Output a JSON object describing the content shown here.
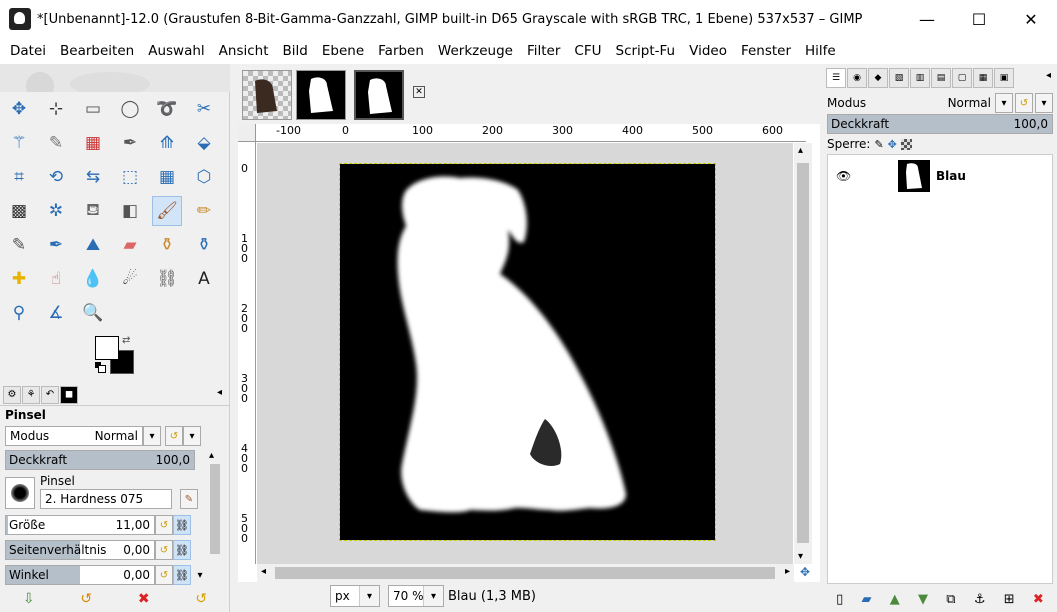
{
  "window": {
    "title": "*[Unbenannt]-12.0 (Graustufen 8-Bit-Gamma-Ganzzahl, GIMP built-in D65 Grayscale with sRGB TRC, 1 Ebene) 537x537 – GIMP",
    "minimize": "—",
    "maximize": "☐",
    "close": "✕"
  },
  "menu": [
    "Datei",
    "Bearbeiten",
    "Auswahl",
    "Ansicht",
    "Bild",
    "Ebene",
    "Farben",
    "Werkzeuge",
    "Filter",
    "CFU",
    "Script-Fu",
    "Video",
    "Fenster",
    "Hilfe"
  ],
  "tools": [
    {
      "name": "move-tool",
      "glyph": "✥",
      "color": "#2a6db5"
    },
    {
      "name": "align-tool",
      "glyph": "⊹",
      "color": "#333"
    },
    {
      "name": "rect-select-tool",
      "glyph": "▭",
      "color": "#555"
    },
    {
      "name": "ellipse-select-tool",
      "glyph": "◯",
      "color": "#555"
    },
    {
      "name": "free-select-tool",
      "glyph": "➰",
      "color": "#555"
    },
    {
      "name": "scissors-tool",
      "glyph": "✂",
      "color": "#2a6db5"
    },
    {
      "name": "fuzzy-select-tool",
      "glyph": "⚚",
      "color": "#2a6db5"
    },
    {
      "name": "magic-wand-tool",
      "glyph": "✎",
      "color": "#777"
    },
    {
      "name": "by-color-select-tool",
      "glyph": "▦",
      "color": "#c33"
    },
    {
      "name": "paths-tool",
      "glyph": "✒",
      "color": "#555"
    },
    {
      "name": "unified-transform-tool",
      "glyph": "⟰",
      "color": "#2a6db5"
    },
    {
      "name": "warp-transform-tool",
      "glyph": "⬙",
      "color": "#2a6db5"
    },
    {
      "name": "crop-tool",
      "glyph": "⌗",
      "color": "#2a6db5"
    },
    {
      "name": "rotate-tool",
      "glyph": "⟲",
      "color": "#2a6db5"
    },
    {
      "name": "flip-tool",
      "glyph": "⇆",
      "color": "#2a6db5"
    },
    {
      "name": "perspective-tool",
      "glyph": "⬚",
      "color": "#2a6db5"
    },
    {
      "name": "cage-tool",
      "glyph": "▦",
      "color": "#2a6db5"
    },
    {
      "name": "handle-transform-tool",
      "glyph": "⬡",
      "color": "#2a6db5"
    },
    {
      "name": "mypaint-brush-tool",
      "glyph": "▩",
      "color": "#333"
    },
    {
      "name": "heal-tool",
      "glyph": "✲",
      "color": "#2a6db5"
    },
    {
      "name": "bucket-fill-tool",
      "glyph": "⛾",
      "color": "#666"
    },
    {
      "name": "gradient-tool",
      "glyph": "◧",
      "color": "#555"
    },
    {
      "name": "paintbrush-tool",
      "glyph": "🖌",
      "color": "#a05a2c"
    },
    {
      "name": "pencil-tool",
      "glyph": "✏",
      "color": "#c88a2c"
    },
    {
      "name": "airbrush-tool",
      "glyph": "✎",
      "color": "#555"
    },
    {
      "name": "ink-tool",
      "glyph": "✒",
      "color": "#2a6db5"
    },
    {
      "name": "mypaint-tool",
      "glyph": "⛰",
      "color": "#2a6db5"
    },
    {
      "name": "eraser-tool",
      "glyph": "▰",
      "color": "#d66"
    },
    {
      "name": "clone-tool",
      "glyph": "⚱",
      "color": "#c88a2c"
    },
    {
      "name": "perspective-clone-tool",
      "glyph": "⚱",
      "color": "#2a6db5"
    },
    {
      "name": "healing-tool",
      "glyph": "✚",
      "color": "#e8b200"
    },
    {
      "name": "smudge-tool",
      "glyph": "☝",
      "color": "#c66"
    },
    {
      "name": "blur-tool",
      "glyph": "💧",
      "color": "#2a6db5"
    },
    {
      "name": "dodge-burn-tool",
      "glyph": "☄",
      "color": "#333"
    },
    {
      "name": "warp-tool",
      "glyph": "⛓",
      "color": "#555"
    },
    {
      "name": "text-tool",
      "glyph": "A",
      "color": "#222"
    },
    {
      "name": "color-picker-tool",
      "glyph": "⚲",
      "color": "#2a6db5"
    },
    {
      "name": "measure-tool",
      "glyph": "∡",
      "color": "#2a6db5"
    },
    {
      "name": "zoom-tool",
      "glyph": "🔍",
      "color": "#555"
    }
  ],
  "tool_options": {
    "title": "Pinsel",
    "modus_label": "Modus",
    "modus_value": "Normal",
    "deckkraft_label": "Deckkraft",
    "deckkraft_value": "100,0",
    "deckkraft_fraction": 1.0,
    "pinsel_label": "Pinsel",
    "pinsel_value": "2. Hardness 075",
    "groesse_label": "Größe",
    "groesse_value": "11,00",
    "groesse_fraction": 0.08,
    "seiten_label": "Seitenverhältnis",
    "seiten_value": "0,00",
    "seiten_fraction": 0.5,
    "winkel_label": "Winkel",
    "winkel_value": "0,00",
    "winkel_fraction": 0.5
  },
  "ruler": {
    "h_ticks": [
      "-100",
      "0",
      "100",
      "200",
      "300",
      "400",
      "500",
      "600"
    ],
    "v_ticks": [
      "0",
      "1\n0\n0",
      "2\n0\n0",
      "3\n0\n0",
      "4\n0\n0",
      "5\n0\n0"
    ]
  },
  "status": {
    "unit": "px",
    "zoom": "70 %",
    "info": "Blau (1,3 MB)"
  },
  "layers": {
    "modus_label": "Modus",
    "modus_value": "Normal",
    "deckkraft_label": "Deckkraft",
    "deckkraft_value": "100,0",
    "deckkraft_fraction": 1.0,
    "sperre_label": "Sperre:",
    "layer_name": "Blau"
  }
}
